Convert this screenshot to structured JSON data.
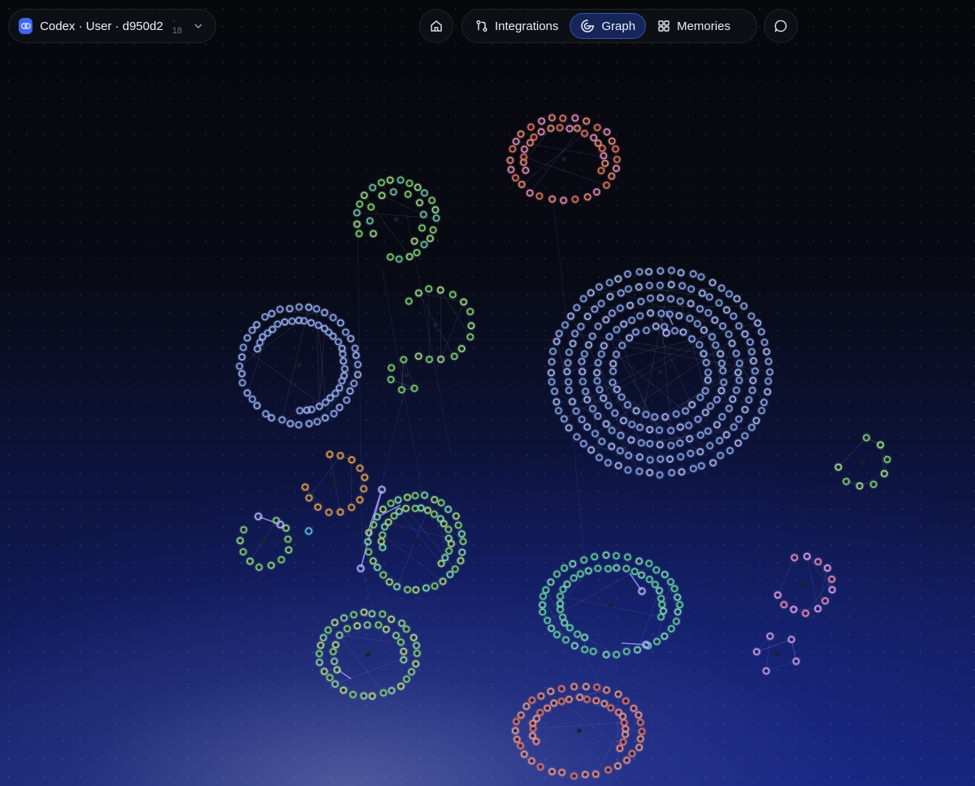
{
  "workspace": {
    "name": "Codex · User · d950d2",
    "count": "· 18",
    "logo_icon": "brain-icon",
    "dropdown_icon": "chevron-down-icon"
  },
  "toolbar": {
    "home_icon": "home-icon",
    "chat_icon": "chat-bubble-icon"
  },
  "nav": {
    "tabs": [
      {
        "label": "Integrations",
        "icon": "integrations-icon",
        "active": false
      },
      {
        "label": "Graph",
        "icon": "graph-icon",
        "active": true
      },
      {
        "label": "Memories",
        "icon": "grid-icon",
        "active": false
      }
    ]
  },
  "colors": {
    "accent": "#3f66f2",
    "active_tab_bg": "#16265a",
    "node_blue": "#8aa3e8",
    "node_green": "#7fcf70",
    "node_red": "#e0735f",
    "node_pink": "#e58ab8",
    "node_teal": "#5fd0a0",
    "node_orange": "#e8a04a",
    "node_purple": "#c79be8",
    "edge": "#9aa6d8",
    "highlight_edge": "#a694ff"
  }
}
